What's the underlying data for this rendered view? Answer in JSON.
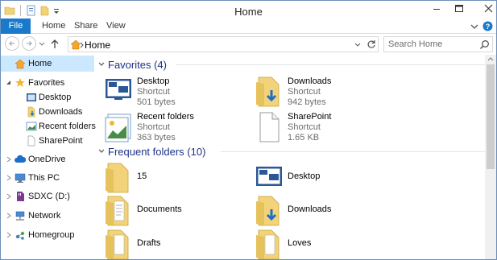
{
  "window": {
    "title": "Home"
  },
  "ribbon": {
    "tabs": [
      "File",
      "Home",
      "Share",
      "View"
    ]
  },
  "address": {
    "path": "Home"
  },
  "search": {
    "placeholder": "Search Home"
  },
  "nav": {
    "home": "Home",
    "favorites": "Favorites",
    "fav_items": [
      "Desktop",
      "Downloads",
      "Recent folders",
      "SharePoint"
    ],
    "onedrive": "OneDrive",
    "thispc": "This PC",
    "sdxc": "SDXC (D:)",
    "network": "Network",
    "homegroup": "Homegroup"
  },
  "favorites_group": {
    "title": "Favorites (4)",
    "items": [
      {
        "name": "Desktop",
        "type": "Shortcut",
        "size": "501 bytes"
      },
      {
        "name": "Downloads",
        "type": "Shortcut",
        "size": "942 bytes"
      },
      {
        "name": "Recent folders",
        "type": "Shortcut",
        "size": "363 bytes"
      },
      {
        "name": "SharePoint",
        "type": "Shortcut",
        "size": "1.65 KB"
      }
    ]
  },
  "frequent_group": {
    "title": "Frequent folders (10)",
    "items": [
      "15",
      "Desktop",
      "Documents",
      "Downloads",
      "Drafts",
      "Loves"
    ]
  },
  "colors": {
    "accent": "#1979ca",
    "group_title": "#1e3287",
    "selected": "#cce8ff"
  }
}
